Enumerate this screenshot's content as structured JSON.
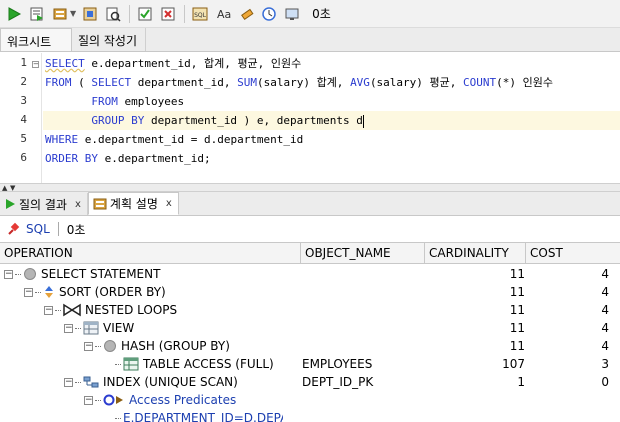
{
  "toolbar": {
    "icons": [
      "run-icon",
      "run-script-icon",
      "explain-plan-icon",
      "autotrace-icon",
      "sql-tuning-icon",
      "commit-icon",
      "rollback-icon",
      "sql-format-icon",
      "case-toggle-icon",
      "clear-icon",
      "history-icon",
      "monitor-icon"
    ],
    "elapsed": "0초"
  },
  "editor_tabs": [
    "워크시트",
    "질의 작성기"
  ],
  "editor": {
    "lines": [
      {
        "n": "1",
        "text": "SELECT e.department_id, 합계, 평균, 인원수"
      },
      {
        "n": "2",
        "text": "FROM ( SELECT department_id, SUM(salary) 합계, AVG(salary) 평균, COUNT(*) 인원수"
      },
      {
        "n": "3",
        "text": "       FROM employees"
      },
      {
        "n": "4",
        "text": "       GROUP BY department_id ) e, departments d"
      },
      {
        "n": "5",
        "text": "WHERE e.department_id = d.department_id"
      },
      {
        "n": "6",
        "text": "ORDER BY e.department_id;"
      }
    ]
  },
  "result_tabs": [
    {
      "label": "질의 결과",
      "close": "x"
    },
    {
      "label": "계획 설명",
      "close": "x"
    }
  ],
  "sqlbar": {
    "sql_label": "SQL",
    "elapsed": "0초"
  },
  "grid": {
    "columns": [
      "OPERATION",
      "OBJECT_NAME",
      "CARDINALITY",
      "COST"
    ],
    "rows": [
      {
        "level": 0,
        "toggle": "−",
        "icon": "circle",
        "op": "SELECT STATEMENT",
        "obj": "",
        "card": "11",
        "cost": "4"
      },
      {
        "level": 1,
        "toggle": "−",
        "icon": "sort",
        "op": "SORT (ORDER BY)",
        "obj": "",
        "card": "11",
        "cost": "4"
      },
      {
        "level": 2,
        "toggle": "−",
        "icon": "loops",
        "op": "NESTED LOOPS",
        "obj": "",
        "card": "11",
        "cost": "4"
      },
      {
        "level": 3,
        "toggle": "−",
        "icon": "view",
        "op": "VIEW",
        "obj": "",
        "card": "11",
        "cost": "4"
      },
      {
        "level": 4,
        "toggle": "−",
        "icon": "circle",
        "op": "HASH (GROUP BY)",
        "obj": "",
        "card": "11",
        "cost": "4"
      },
      {
        "level": 5,
        "toggle": "",
        "icon": "table",
        "op": "TABLE ACCESS (FULL)",
        "obj": "EMPLOYEES",
        "card": "107",
        "cost": "3"
      },
      {
        "level": 3,
        "toggle": "−",
        "icon": "index",
        "op": "INDEX (UNIQUE SCAN)",
        "obj": "DEPT_ID_PK",
        "card": "1",
        "cost": "0"
      },
      {
        "level": 4,
        "toggle": "−",
        "icon": "pred",
        "op": "Access Predicates",
        "obj": "",
        "card": "",
        "cost": ""
      },
      {
        "level": 5,
        "toggle": "",
        "icon": "",
        "op": "E.DEPARTMENT_ID=D.DEPA",
        "obj": "",
        "card": "",
        "cost": ""
      }
    ]
  },
  "colors": {
    "keyword": "#2b3ccf",
    "highlight": "#fdf8e0",
    "link": "#1c3fb0"
  }
}
